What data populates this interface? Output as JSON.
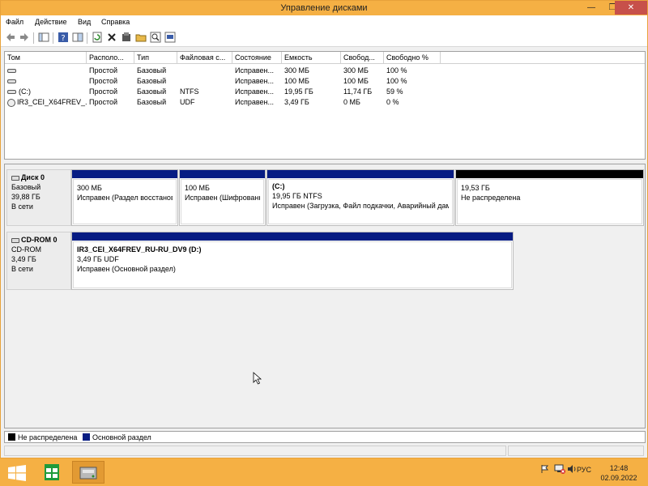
{
  "window": {
    "title": "Управление дисками",
    "minimize_glyph": "—",
    "maximize_glyph": "❐",
    "close_glyph": "✕"
  },
  "menu": [
    "Файл",
    "Действие",
    "Вид",
    "Справка"
  ],
  "toolbar": {
    "icons": [
      "back-icon",
      "forward-icon",
      "console-tree-icon",
      "help-icon",
      "properties-icon",
      "refresh-icon",
      "delete-icon",
      "settings-icon",
      "folder-open-icon",
      "search-icon",
      "disk-wizard-icon"
    ]
  },
  "volume_list": {
    "columns": [
      "Том",
      "Располо...",
      "Тип",
      "Файловая с...",
      "Состояние",
      "Емкость",
      "Свобод...",
      "Свободно %"
    ],
    "rows": [
      {
        "name": "",
        "layout": "Простой",
        "type": "Базовый",
        "fs": "",
        "status": "Исправен...",
        "capacity": "300 МБ",
        "free": "300 МБ",
        "free_pct": "100 %"
      },
      {
        "name": "",
        "layout": "Простой",
        "type": "Базовый",
        "fs": "",
        "status": "Исправен...",
        "capacity": "100 МБ",
        "free": "100 МБ",
        "free_pct": "100 %"
      },
      {
        "name": "(C:)",
        "layout": "Простой",
        "type": "Базовый",
        "fs": "NTFS",
        "status": "Исправен...",
        "capacity": "19,95 ГБ",
        "free": "11,74 ГБ",
        "free_pct": "59 %"
      },
      {
        "name": "IR3_CEI_X64FREV_...",
        "layout": "Простой",
        "type": "Базовый",
        "fs": "UDF",
        "status": "Исправен...",
        "capacity": "3,49 ГБ",
        "free": "0 МБ",
        "free_pct": "0 %"
      }
    ]
  },
  "disks": [
    {
      "name": "Диск 0",
      "kind": "Базовый",
      "size": "39,88 ГБ",
      "state": "В сети",
      "partitions": [
        {
          "title": "",
          "size": "300 МБ",
          "status": "Исправен (Раздел восстановления)"
        },
        {
          "title": "",
          "size": "100 МБ",
          "status": "Исправен (Шифрованный (EFI) системный раздел)"
        },
        {
          "title": "(C:)",
          "size": "19,95 ГБ NTFS",
          "status": "Исправен (Загрузка, Файл подкачки, Аварийный дамп памяти, Основной раздел)"
        },
        {
          "title": "",
          "size": "19,53 ГБ",
          "status": "Не распределена"
        }
      ]
    },
    {
      "name": "CD-ROM 0",
      "kind": "CD-ROM",
      "size": "3,49 ГБ",
      "state": "В сети",
      "partitions": [
        {
          "title": "IR3_CEI_X64FREV_RU-RU_DV9  (D:)",
          "size": "3,49 ГБ UDF",
          "status": "Исправен (Основной раздел)"
        }
      ]
    }
  ],
  "legend": [
    {
      "label": "Не распределена",
      "color": "#000000"
    },
    {
      "label": "Основной раздел",
      "color": "#071c83"
    }
  ],
  "taskbar": {
    "lang": "РУС",
    "time": "12:48",
    "date": "02.09.2022"
  },
  "colors": {
    "accent": "#f5b044",
    "partition_bar": "#071c83",
    "unallocated": "#000000"
  }
}
